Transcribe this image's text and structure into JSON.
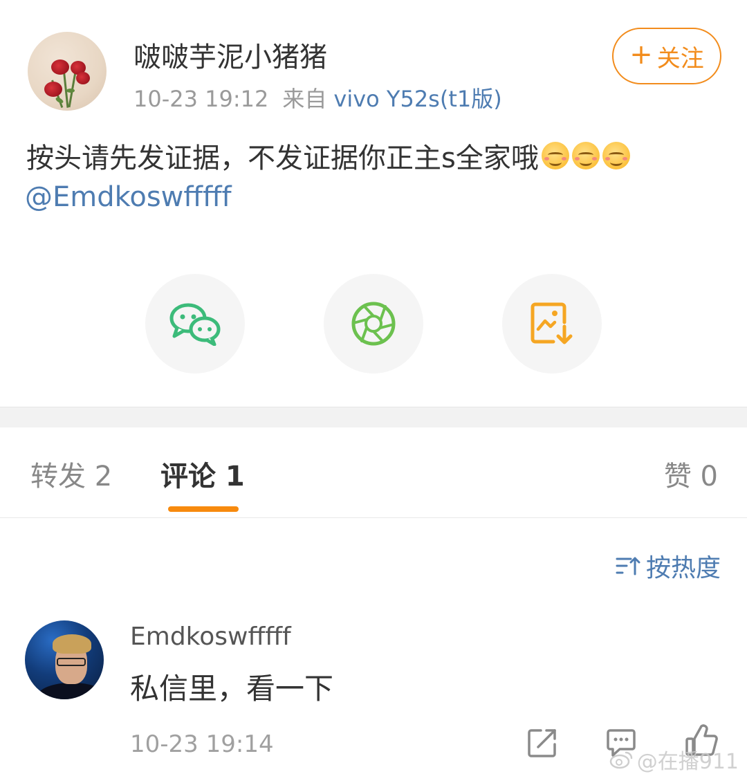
{
  "post": {
    "username": "啵啵芋泥小猪猪",
    "time": "10-23 19:12",
    "from_label": "来自",
    "source": "vivo Y52s(t1版)",
    "follow_label": "关注",
    "text": "按头请先发证据，不发证据你正主s全家哦",
    "emoji": [
      "smile-emoji",
      "smile-emoji",
      "smile-emoji"
    ],
    "mention": "@Emdkoswfffff"
  },
  "share": [
    {
      "name": "wechat-icon",
      "color": "#3cbb7a"
    },
    {
      "name": "moments-icon",
      "color": "#6cc14f"
    },
    {
      "name": "save-image-icon",
      "color": "#f5a623"
    }
  ],
  "tabs": {
    "repost": "转发 2",
    "comment": "评论 1",
    "like": "赞 0",
    "active": "comment",
    "accent": "#f78a0e"
  },
  "sort_label": "按热度",
  "comment": {
    "username": "Emdkoswfffff",
    "text": "私信里，看一下",
    "time": "10-23 19:14"
  },
  "watermark": "@在播911",
  "colors": {
    "link": "#4e7cb1",
    "orange": "#f28c1c"
  }
}
